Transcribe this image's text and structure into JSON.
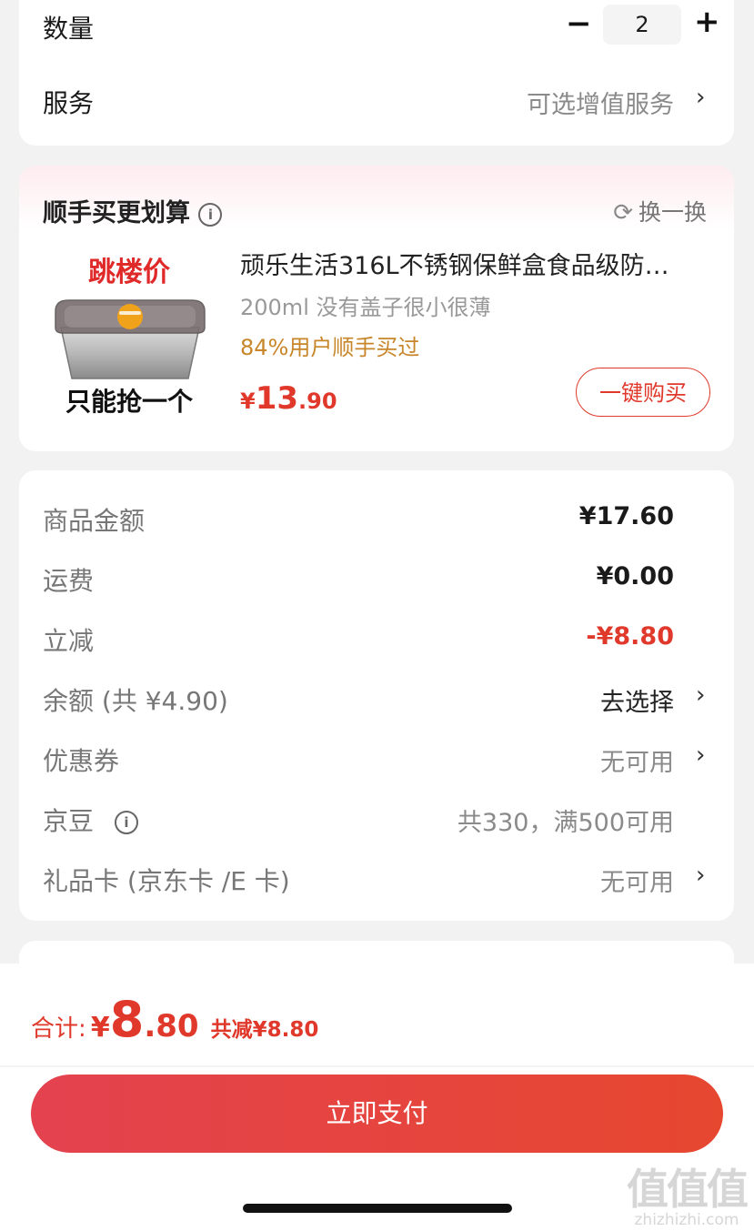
{
  "quantity": {
    "label": "数量",
    "minus": "−",
    "value": "2",
    "plus": "+"
  },
  "service": {
    "label": "服务",
    "value": "可选增值服务",
    "chevron": "›"
  },
  "recommend": {
    "title": "顺手买更划算",
    "info_icon": "i",
    "swap_icon": "⟳",
    "swap_label": "换一换",
    "product": {
      "image_top": "跳楼价",
      "image_bottom": "只能抢一个",
      "name": "顽乐生活316L不锈钢保鲜盒食品级防…",
      "spec": "200ml 没有盖子很小很薄",
      "buyers": "84%用户顺手买过",
      "price_symbol": "¥",
      "price_int": "13",
      "price_dec": ".90",
      "buy_button": "一键购买"
    }
  },
  "summary": {
    "rows": [
      {
        "label": "商品金额",
        "value": "¥17.60"
      },
      {
        "label": "运费",
        "value": "¥0.00"
      },
      {
        "label": "立减",
        "value": "-¥8.80"
      },
      {
        "label": "余额 (共 ¥4.90)",
        "value": "去选择"
      },
      {
        "label": "优惠券",
        "value": "无可用"
      },
      {
        "label": "京豆",
        "value": "共330，满500可用"
      },
      {
        "label": "礼品卡 (京东卡 /E 卡)",
        "value": "无可用"
      }
    ],
    "info_icon": "i",
    "chevron": "›"
  },
  "footer": {
    "total_label": "合计:",
    "total_symbol": "¥",
    "total_int": "8",
    "total_dec": ".80",
    "saved": "共减¥8.80",
    "pay_button": "立即支付",
    "watermark_big": "值值值",
    "watermark_small": "zhizhizhi.com"
  },
  "colors": {
    "accent": "#e0392b",
    "buyers": "#c8862a",
    "background": "#f2f2f2"
  }
}
